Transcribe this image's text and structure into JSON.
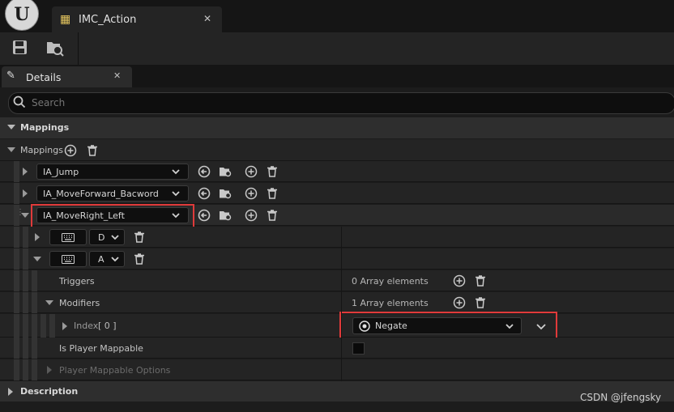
{
  "asset_tab": {
    "label": "IMC_Action"
  },
  "details_tab": {
    "label": "Details"
  },
  "search": {
    "placeholder": "Search"
  },
  "categories": {
    "mappings": "Mappings",
    "description": "Description"
  },
  "mappings_array": {
    "label": "Mappings"
  },
  "actions": [
    {
      "label": "IA_Jump"
    },
    {
      "label": "IA_MoveForward_Bacword"
    },
    {
      "label": "IA_MoveRight_Left"
    }
  ],
  "keys": [
    {
      "label": "D"
    },
    {
      "label": "A"
    }
  ],
  "properties": {
    "triggers": {
      "label": "Triggers",
      "value": "0 Array elements"
    },
    "modifiers": {
      "label": "Modifiers",
      "value": "1 Array elements"
    },
    "index": {
      "label": "Index",
      "index_value": "[ 0 ]"
    },
    "modifier_class": "Negate",
    "is_player_mappable": "Is Player Mappable",
    "player_mappable_options": "Player Mappable Options"
  },
  "watermark": "CSDN @jfengsky",
  "colors": {
    "highlight_border": "#e03a3a",
    "panel_bg": "#1c1c1c"
  }
}
